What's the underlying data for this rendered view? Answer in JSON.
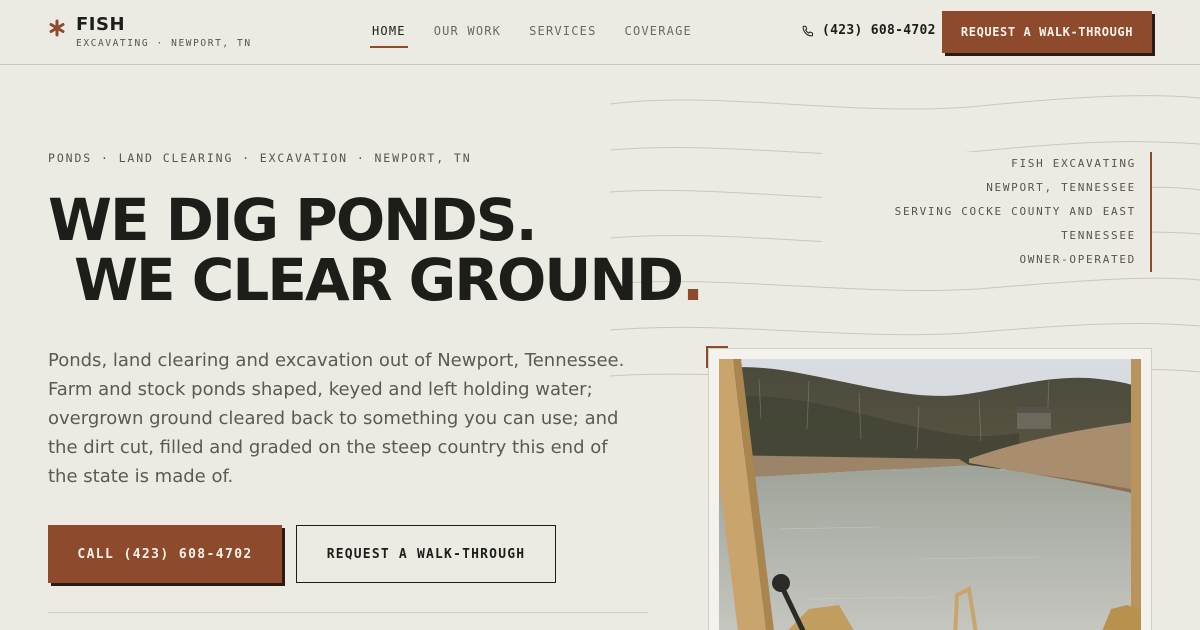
{
  "brand": {
    "name": "FISH",
    "tagline": "EXCAVATING · NEWPORT, TN",
    "accent_color": "#8e4a2c",
    "mark_icon": "asterisk-icon"
  },
  "nav": {
    "items": [
      {
        "label": "HOME",
        "active": true
      },
      {
        "label": "OUR WORK",
        "active": false
      },
      {
        "label": "SERVICES",
        "active": false
      },
      {
        "label": "COVERAGE",
        "active": false
      }
    ]
  },
  "header": {
    "phone": "(423) 608-4702",
    "phone_icon": "phone-icon",
    "cta_label": "REQUEST A WALK-THROUGH"
  },
  "hero": {
    "kicker": "PONDS · LAND CLEARING · EXCAVATION · NEWPORT, TN",
    "headline_line1": "WE DIG PONDS.",
    "headline_line2": "WE CLEAR GROUND",
    "headline_dot": ".",
    "intro": "Ponds, land clearing and excavation out of Newport, Tennessee. Farm and stock ponds shaped, keyed and left holding water; overgrown ground cleared back to something you can use; and the dirt cut, filled and graded on the steep country this end of the state is made of.",
    "call_button": "CALL (423) 608-4702",
    "request_button": "REQUEST A WALK-THROUGH"
  },
  "info": {
    "lines": [
      "FISH EXCAVATING",
      "NEWPORT, TENNESSEE",
      "SERVING COCKE COUNTY AND EAST TENNESSEE",
      "OWNER-OPERATED"
    ]
  }
}
